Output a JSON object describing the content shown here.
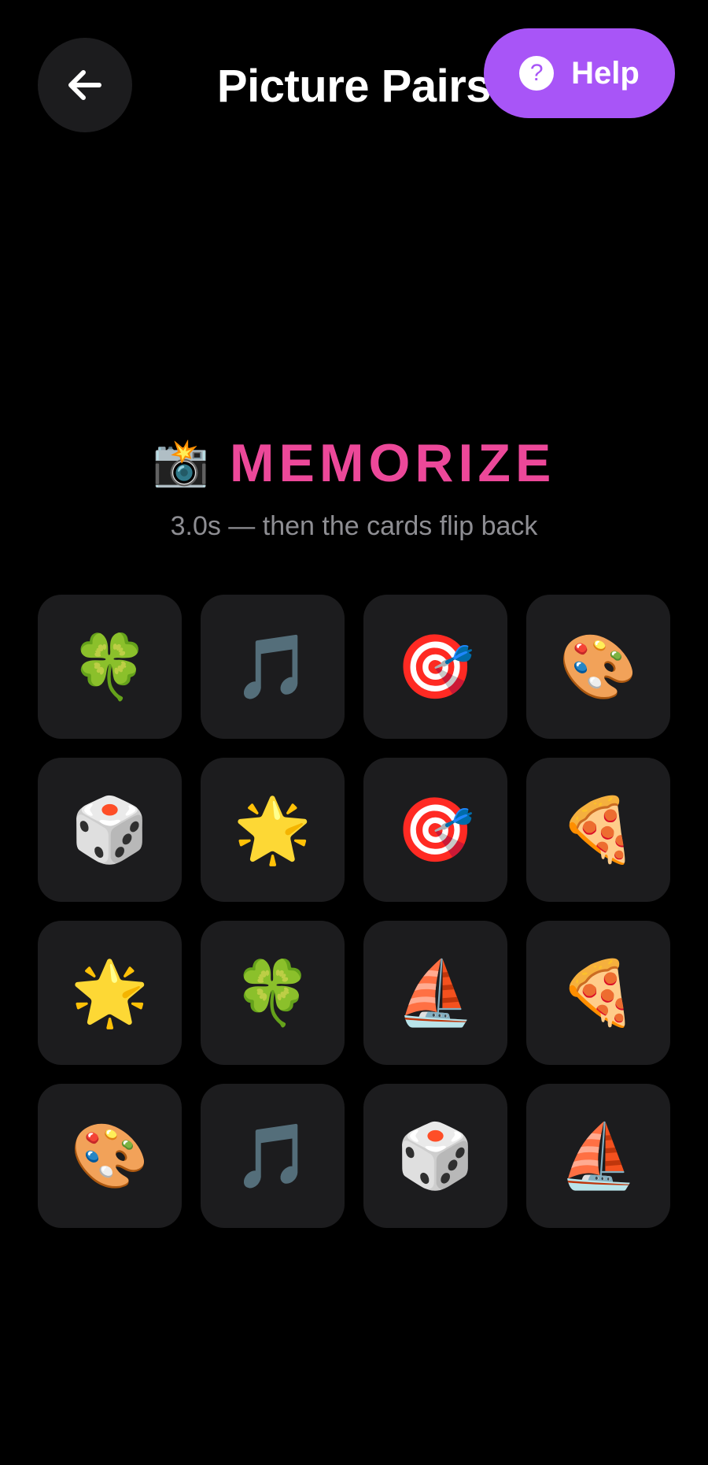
{
  "header": {
    "title": "Picture Pairs",
    "help_label": "Help",
    "help_icon_glyph": "?"
  },
  "phase": {
    "icon": "📸",
    "label": "MEMORIZE",
    "color": "#ec4899",
    "subtitle": "3.0s — then the cards flip back"
  },
  "colors": {
    "accent_purple": "#a855f7",
    "card_bg": "#1c1c1e",
    "background": "#000000"
  },
  "cards": [
    {
      "emoji": "🍀",
      "name": "clover"
    },
    {
      "emoji": "🎵",
      "name": "music-note"
    },
    {
      "emoji": "🎯",
      "name": "target"
    },
    {
      "emoji": "🎨",
      "name": "palette"
    },
    {
      "emoji": "🎲",
      "name": "die"
    },
    {
      "emoji": "🌟",
      "name": "star"
    },
    {
      "emoji": "🎯",
      "name": "target"
    },
    {
      "emoji": "🍕",
      "name": "pizza"
    },
    {
      "emoji": "🌟",
      "name": "star"
    },
    {
      "emoji": "🍀",
      "name": "clover"
    },
    {
      "emoji": "⛵",
      "name": "sailboat"
    },
    {
      "emoji": "🍕",
      "name": "pizza"
    },
    {
      "emoji": "🎨",
      "name": "palette"
    },
    {
      "emoji": "🎵",
      "name": "music-note"
    },
    {
      "emoji": "🎲",
      "name": "die"
    },
    {
      "emoji": "⛵",
      "name": "sailboat"
    }
  ]
}
